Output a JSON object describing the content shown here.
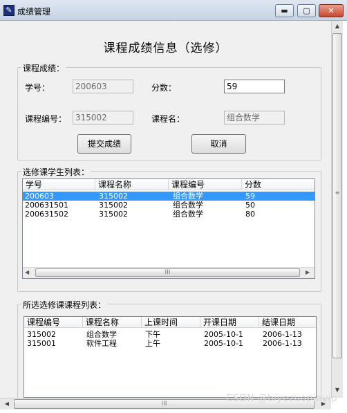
{
  "window": {
    "title": "成绩管理",
    "minimize_glyph": "▬",
    "maximize_glyph": "▢",
    "close_glyph": "✕"
  },
  "form": {
    "heading": "课程成绩信息（选修）",
    "score_group_label": "课程成绩：",
    "student_id_label": "学号：",
    "student_id_value": "200603",
    "score_label": "分数：",
    "score_value": "59",
    "course_id_label": "课程编号：",
    "course_id_value": "315002",
    "course_name_label": "课程名：",
    "course_name_value": "组合数学",
    "submit_label": "提交成绩",
    "cancel_label": "取消"
  },
  "students": {
    "group_label": "选修课学生列表：",
    "columns": [
      "学号",
      "课程名称",
      "课程编号",
      "分数"
    ],
    "rows": [
      {
        "selected": true,
        "cells": [
          "200603",
          "315002",
          "组合数学",
          "59"
        ]
      },
      {
        "selected": false,
        "cells": [
          "200631501",
          "315002",
          "组合数学",
          "50"
        ]
      },
      {
        "selected": false,
        "cells": [
          "200631502",
          "315002",
          "组合数学",
          "80"
        ]
      }
    ],
    "scroll_grip": "III"
  },
  "courses": {
    "group_label": "所选选修课课程列表：",
    "columns": [
      "课程编号",
      "课程名称",
      "上课时间",
      "开课日期",
      "结课日期"
    ],
    "rows": [
      {
        "cells": [
          "315002",
          "组合数学",
          "下午",
          "2005-10-1",
          "2006-1-13"
        ]
      },
      {
        "cells": [
          "315001",
          "软件工程",
          "上午",
          "2005-10-1",
          "2006-1-13"
        ]
      }
    ]
  },
  "window_scroll": {
    "grip_v": "≡",
    "grip_h": "III"
  },
  "watermark": "CSDN @biyezuopinvip"
}
